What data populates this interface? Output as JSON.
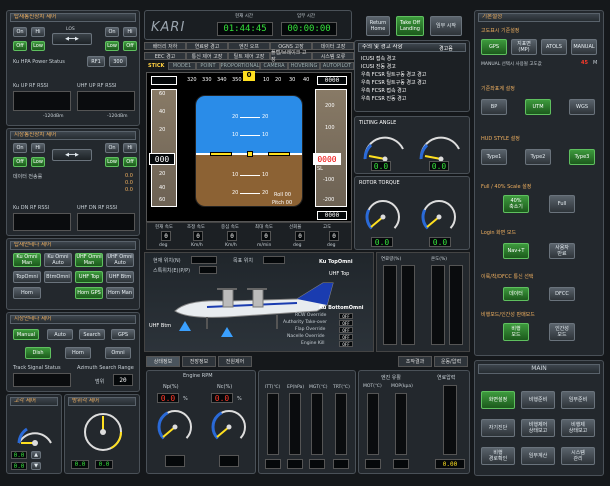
{
  "left": {
    "p1_title": "탑재통신장치 제어",
    "on": "On",
    "hi": "Hi",
    "low": "Low",
    "off": "Off",
    "p1_los": "LOS",
    "p1_hpa": "Ku HPA Power Status",
    "p1_r1": "RF1",
    "p1_r2": "300",
    "p1_rf1": "Ku UP RF RSSI",
    "p1_rf2": "UHF UP RF RSSI",
    "p1_db1": "-120dBm",
    "p1_db2": "-120dBm",
    "p2_title": "지상통신장치 제어",
    "p2_status": "데이터 전송률",
    "p2_kv": [
      "0.0",
      "0.0",
      "0.0"
    ],
    "p2_rf1": "Ku DN RF RSSI",
    "p2_rf2": "UHF DN RF RSSI",
    "p3_title": "탑재안테나 제어",
    "p3_btns": [
      "Ku Omni\nMan",
      "Ku Omni\nAuto",
      "UHF Omni\nMan",
      "UHF Omni\nAuto",
      "TopOmni",
      "BtmOmni",
      "UHF Top",
      "UHF Btm",
      "Horn",
      "",
      "Horn GPS",
      "Horn Man"
    ],
    "p4_title": "지상안테나 제어",
    "p4_btns": [
      "Manual",
      "Auto",
      "Search",
      "GPS",
      "Dish",
      "Horn",
      "Omni"
    ],
    "p4_track": "Track Signal Status",
    "p4_az": "Azimuth Search Range",
    "p4_range_label": "범위",
    "p4_range_val": "20",
    "p5_title": "고각 제어",
    "p6_title": "방위각 제어",
    "p5_vals": [
      "0.0",
      "0.0"
    ],
    "p6_vals": [
      "0.0",
      "0.0"
    ]
  },
  "top": {
    "logo": "KARI",
    "cur_time_label": "현재 시간",
    "cur_time": "01:44:45",
    "flight_time_label": "임무 시간",
    "flight_time": "00:00:00",
    "return_home": "Return\nHome",
    "takeoff": "Take Off\nLanding",
    "mission": "임무 시작",
    "warn_tabs": [
      "배터리 저하",
      "연료량 경고",
      "엔진 오프",
      "OGNS 고장",
      "데이터 고장"
    ],
    "warn_tabs2": [
      "EEC 경고",
      "통신 제어 고장",
      "틸트 제어 고장",
      "플랩/브레이크 고장",
      "시스템 오류"
    ],
    "mode_label": "STICK",
    "mode_tabs": [
      "MODE1",
      "POINT",
      "PROPORTIONAL",
      "CAMERA",
      "HOVERING",
      "AUTOPILOT"
    ]
  },
  "pfd": {
    "heading_ticks": [
      "320",
      "330",
      "340",
      "350",
      "0",
      "10",
      "20",
      "30",
      "40"
    ],
    "heading_val": "0",
    "speed_val": "000",
    "alt_val": "0000",
    "vs_val": "0000",
    "pitch_labels": [
      "20",
      "10",
      "10",
      "20"
    ],
    "alt_ticks": [
      "200",
      "100",
      "-100",
      "-200"
    ],
    "speed_ticks": [
      "60",
      "40",
      "20",
      "20",
      "40",
      "60"
    ],
    "sl": "SL",
    "roll": "Roll  00",
    "pitch": "Pitch 00",
    "bottom_labels": [
      "현재 속도",
      "조정 속도",
      "중심 속도",
      "최대 속도",
      "선회율",
      "고도"
    ],
    "bottom_units": [
      "deg",
      "Km/h",
      "Km/h",
      "m/min",
      "deg",
      "deg"
    ],
    "bottom_vals": [
      "0",
      "0",
      "0",
      "0",
      "0",
      "0"
    ]
  },
  "caution": {
    "title": "주의 및 경고 사항",
    "clear": "경고음",
    "items": [
      "ICUSI 접속 경고",
      "ICUSI 진동 경고",
      "우측 FCSR 틸트구동 경고 경고",
      "우측 FCSR 틸트구동 경고 경고",
      "우측 FCSR 접속 경고",
      "우측 FCSR 진동 경고"
    ]
  },
  "tilt": {
    "title": "TILTING ANGLE",
    "vals": [
      "0.0",
      "0.0"
    ]
  },
  "rotor": {
    "title": "ROTOR TORQUE",
    "vals": [
      "0.0",
      "0.0"
    ]
  },
  "mid": {
    "cur_heading": "현재 위치(N)",
    "dest": "목표 위치",
    "ppm": "스톡위치(E)(P/P)",
    "ku_top": "Ku TopOmni",
    "uhf_top": "UHF Top",
    "uhf_btm": "UHF Btm",
    "ku_btm": "Ku BottomOmni",
    "overrides": [
      "RCW Override",
      "Authority Take-over",
      "Flap Override",
      "Nacelle Override",
      "Engine Kill"
    ],
    "off": "OFF",
    "fuel_label": "연료량(%)",
    "temp_label": "온도(%)",
    "tabs": [
      "상태정보",
      "전장정보",
      "전원제어"
    ],
    "tabs2": [
      "조작결과",
      "운동/압력"
    ]
  },
  "engine": {
    "title": "Engine RPM",
    "n1": "Np(%)",
    "n2": "Nc(%)",
    "n1_val": "0.0",
    "n2_val": "0.0",
    "n1_unit": "%",
    "n2_unit": "%",
    "bar_labels": [
      "ITT(℃)",
      "EP(hPa)",
      "MGT(℃)",
      "TRT(℃)"
    ],
    "oil_title": "엔진 유활",
    "oil_labels": [
      "MOT(℃)",
      "MOP(kpa)"
    ],
    "fuel_title": "연료압력",
    "fuel_val": "0.00"
  },
  "right": {
    "p1_title": "기본설정",
    "p1_sub": "고도표시 기준설정",
    "p1_btns": [
      "GPS",
      "지표면\n(MP)",
      "ATOLS",
      "MANUAL"
    ],
    "p1_manual": "MANUAL 선택시 사용될 고도값",
    "p1_val": "45",
    "p1_unit": "M",
    "p2_title": "기준좌표계 설정",
    "p2_btns": [
      "BP",
      "UTM",
      "WGS"
    ],
    "p3_title": "HUD STYLE 설정",
    "p3_btns": [
      "Type1",
      "Type2",
      "Type3"
    ],
    "p4_title": "Full / 40% Scale 설정",
    "p4_btns": [
      "40%\n축소기",
      "Full"
    ],
    "p5_title": "Login 화면 모드",
    "p5_btns": [
      "Nav+T",
      "사용자\n만료"
    ],
    "p6_title": "이륙/착/DFCC 통신 선택",
    "p6_btns": [
      "데이터",
      "DFCC"
    ],
    "p7_title": "비행모드/인간성 판매모드",
    "p7_btns": [
      "비행\n모드",
      "인간성\n모드"
    ],
    "main": "MAIN",
    "main_btns": [
      "화면설정",
      "비행준비",
      "임무준비",
      "자기진단",
      "비행제어\n상태보고",
      "비행제\n상태보고",
      "비행\n경로확인",
      "임무계산",
      "시스템\n관리"
    ]
  }
}
